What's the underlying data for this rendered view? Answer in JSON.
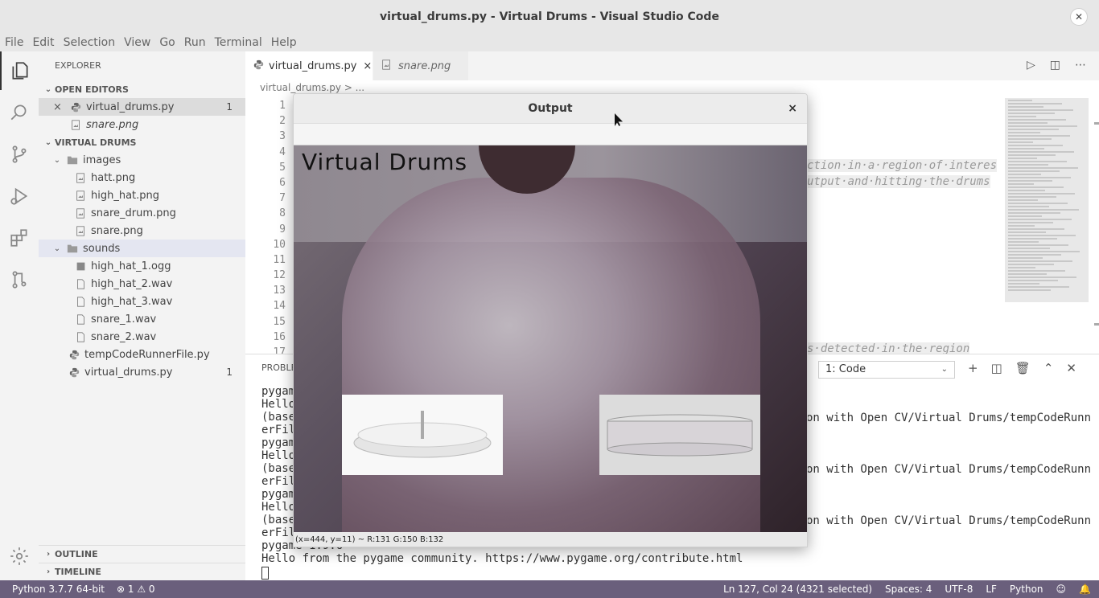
{
  "window": {
    "title": "virtual_drums.py - Virtual Drums - Visual Studio Code"
  },
  "menu": [
    "File",
    "Edit",
    "Selection",
    "View",
    "Go",
    "Run",
    "Terminal",
    "Help"
  ],
  "sidebar": {
    "title": "EXPLORER",
    "open_editors_label": "OPEN EDITORS",
    "open_editors": [
      {
        "name": "virtual_drums.py",
        "badge": "1"
      },
      {
        "name": "snare.png"
      }
    ],
    "project_label": "VIRTUAL DRUMS",
    "tree": {
      "images_folder": "images",
      "images": [
        "hatt.png",
        "high_hat.png",
        "snare_drum.png",
        "snare.png"
      ],
      "sounds_folder": "sounds",
      "sounds": [
        "high_hat_1.ogg",
        "high_hat_2.wav",
        "high_hat_3.wav",
        "snare_1.wav",
        "snare_2.wav"
      ],
      "root_files": [
        {
          "name": "tempCodeRunnerFile.py"
        },
        {
          "name": "virtual_drums.py",
          "badge": "1"
        }
      ]
    },
    "outline_label": "OUTLINE",
    "timeline_label": "TIMELINE"
  },
  "tabs": [
    {
      "label": "virtual_drums.py",
      "close": "×"
    },
    {
      "label": "snare.png"
    }
  ],
  "breadcrumb": "virtual_drums.py > ...",
  "editor": {
    "line_numbers": [
      "1",
      "2",
      "3",
      "4",
      "5",
      "6",
      "7",
      "8",
      "9",
      "10",
      "11",
      "12",
      "13",
      "14",
      "15",
      "16",
      "17"
    ],
    "frag_1": "ction·in·a·region·of·interes",
    "frag_2": "utput·and·hitting·the·drums",
    "frag_3": "s·detected·in·the·region"
  },
  "panel": {
    "tab_label": "PROBLE",
    "terminal_select": "1: Code",
    "left_lines": [
      "pygam",
      "Hello",
      "(base",
      "erFil",
      "pygam",
      "Hello",
      "(base",
      "erFil",
      "pygam",
      "Hello",
      "(base",
      "erFil",
      "pygame 1.9.6"
    ],
    "right_lines": [
      "on with Open CV/Virtual Drums/tempCodeRunn",
      "on with Open CV/Virtual Drums/tempCodeRunn",
      "on with Open CV/Virtual Drums/tempCodeRunn"
    ],
    "last_line": "Hello from the pygame community. https://www.pygame.org/contribute.html"
  },
  "output_window": {
    "title": "Output",
    "close": "×",
    "heading": "Virtual Drums",
    "pixel_info": "(x=444, y=11) ~ R:131 G:150 B:132"
  },
  "statusbar": {
    "python": "Python 3.7.7 64-bit",
    "errors": "⊗ 1 ⚠ 0",
    "position": "Ln 127, Col 24 (4321 selected)",
    "spaces": "Spaces: 4",
    "encoding": "UTF-8",
    "eol": "LF",
    "language": "Python"
  },
  "colors": {
    "statusbar": "#6a5f7c",
    "titlebar": "#e7e7e7",
    "sidebar": "#f3f3f3"
  }
}
